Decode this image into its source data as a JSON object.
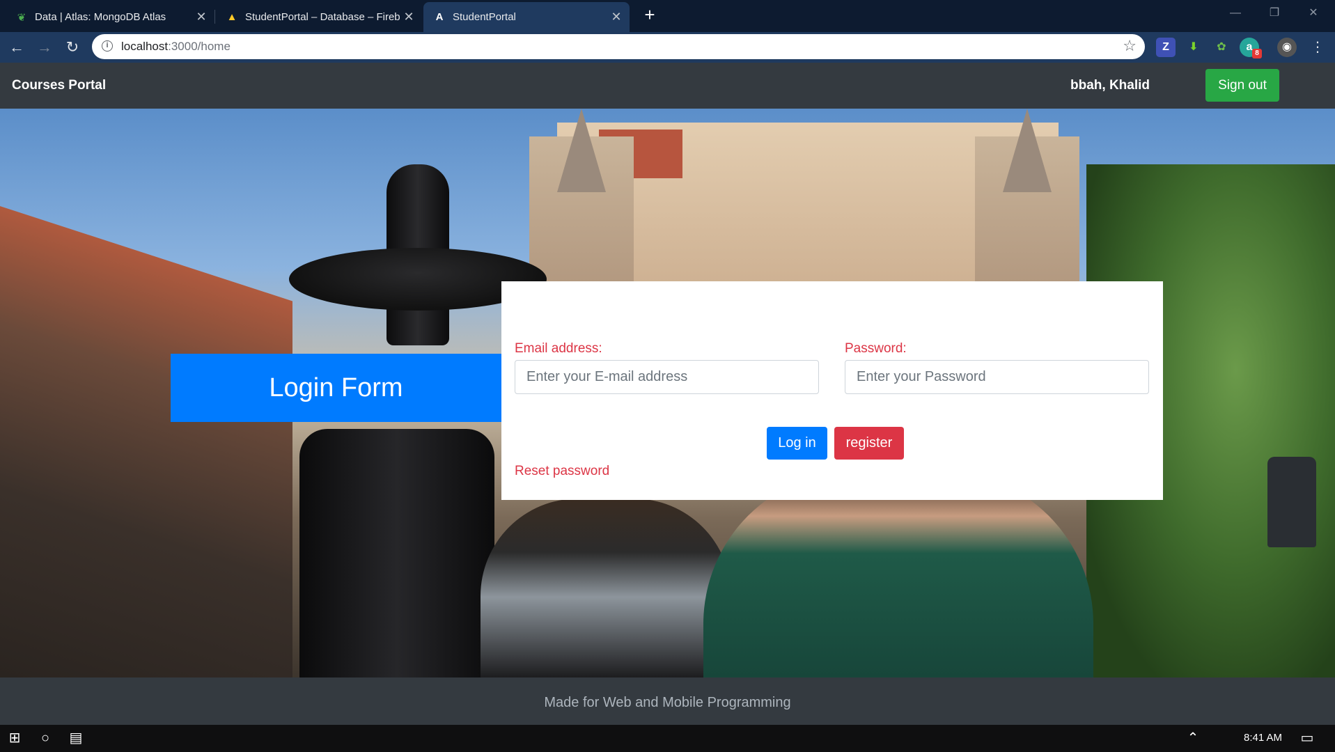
{
  "browser": {
    "tabs": [
      {
        "title": "Data | Atlas: MongoDB Atlas",
        "icon": "mongodb-leaf-icon",
        "active": false
      },
      {
        "title": "StudentPortal – Database – Fireb",
        "icon": "firebase-icon",
        "active": false
      },
      {
        "title": "StudentPortal",
        "icon": "angular-icon",
        "active": true
      }
    ],
    "url_host": "localhost",
    "url_rest": ":3000/home",
    "extension_badge": "8"
  },
  "navbar": {
    "brand": "Courses Portal",
    "user_name": "bbah, Khalid",
    "signout_label": "Sign out"
  },
  "login": {
    "title": "Login Form",
    "email_label": "Email address:",
    "email_placeholder": "Enter your E-mail address",
    "password_label": "Password:",
    "password_placeholder": "Enter your Password",
    "login_button": "Log in",
    "register_button": "register",
    "reset_link": "Reset password"
  },
  "footer": {
    "text": "Made for Web and Mobile Programming"
  },
  "taskbar": {
    "time": "8:41 AM"
  },
  "colors": {
    "primary": "#007bff",
    "danger": "#dc3545",
    "success": "#28a745",
    "navbar_bg": "#343a40",
    "chrome_bg": "#1f3a5f"
  }
}
